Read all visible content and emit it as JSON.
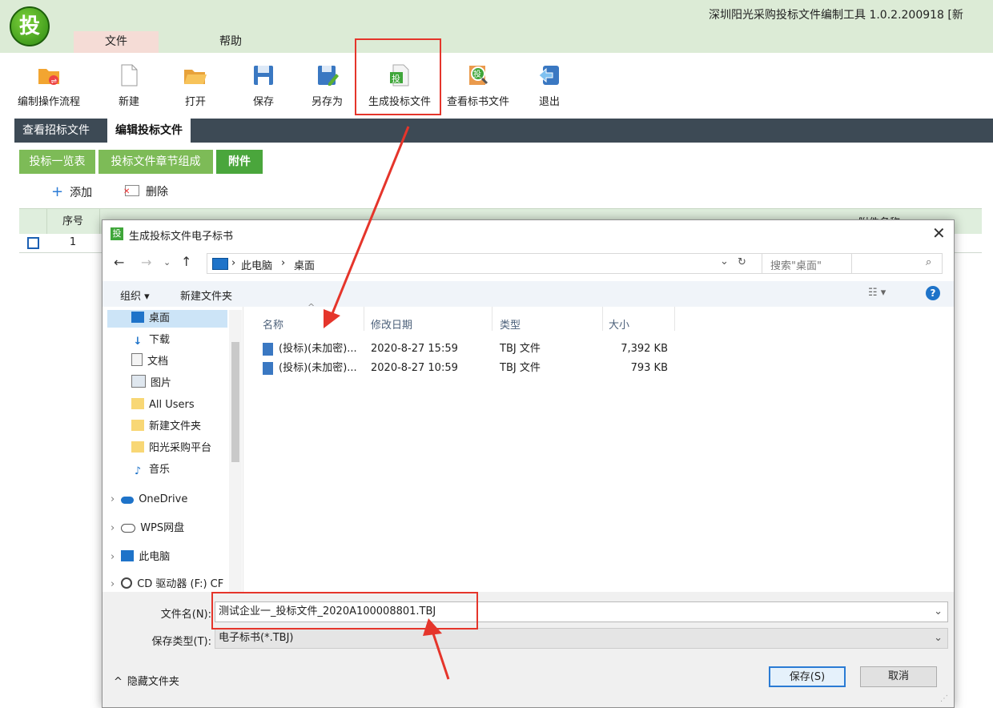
{
  "app": {
    "title": "深圳阳光采购投标文件编制工具 1.0.2.200918 [新",
    "logo_text": "投"
  },
  "menu": {
    "file": "文件",
    "help": "帮助"
  },
  "toolbar": {
    "edit_flow": "编制操作流程",
    "new": "新建",
    "open": "打开",
    "save": "保存",
    "save_as": "另存为",
    "generate_bid": "生成投标文件",
    "view_bid": "查看标书文件",
    "exit": "退出"
  },
  "main_tabs": {
    "view_tender": "查看招标文件",
    "edit_bid": "编辑投标文件"
  },
  "sub_tabs": {
    "overview": "投标一览表",
    "chapters": "投标文件章节组成",
    "attachment": "附件"
  },
  "actions": {
    "add": "添加",
    "delete": "删除"
  },
  "table": {
    "col_no": "序号",
    "col_name": "附件名称",
    "row1_no": "1"
  },
  "dialog": {
    "title": "生成投标文件电子标书",
    "breadcrumb": [
      "此电脑",
      "桌面"
    ],
    "search_placeholder": "搜索\"桌面\"",
    "organize": "组织 ▾",
    "new_folder": "新建文件夹",
    "nav": {
      "desktop": "桌面",
      "downloads": "下载",
      "documents": "文档",
      "pictures": "图片",
      "all_users": "All Users",
      "new_folder": "新建文件夹",
      "sunshine": "阳光采购平台",
      "music": "音乐",
      "onedrive": "OneDrive",
      "wps": "WPS网盘",
      "this_pc": "此电脑",
      "cd_drive": "CD 驱动器 (F:) CF"
    },
    "columns": {
      "name": "名称",
      "modified": "修改日期",
      "type": "类型",
      "size": "大小"
    },
    "files": [
      {
        "name": "(投标)(未加密)...",
        "modified": "2020-8-27 15:59",
        "type": "TBJ 文件",
        "size": "7,392 KB"
      },
      {
        "name": "(投标)(未加密)...",
        "modified": "2020-8-27 10:59",
        "type": "TBJ 文件",
        "size": "793 KB"
      }
    ],
    "filename_label": "文件名(N):",
    "filename_value": "测试企业一_投标文件_2020A100008801.TBJ",
    "savetype_label": "保存类型(T):",
    "savetype_value": "电子标书(*.TBJ)",
    "hide_folders": "隐藏文件夹",
    "save_btn": "保存(S)",
    "cancel_btn": "取消"
  },
  "colors": {
    "accent_green": "#7dbb57",
    "dark_tab_bar": "#3d4a55",
    "highlight_red": "#e5352b"
  }
}
